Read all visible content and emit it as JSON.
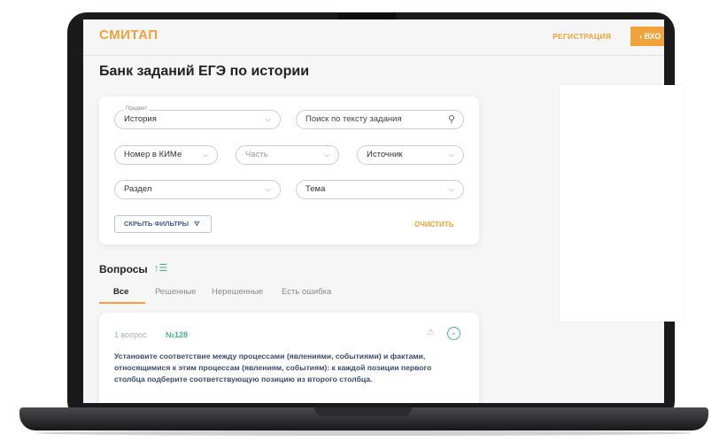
{
  "header": {
    "logo": "СМИТАП",
    "register": "РЕГИСТРАЦИЯ",
    "login": "› ВХО"
  },
  "page": {
    "title": "Банк заданий ЕГЭ по истории"
  },
  "filters": {
    "subject_legend": "Предмет",
    "subject_value": "История",
    "search_placeholder": "Поиск по тексту задания",
    "kim_number": "Номер в КИМе",
    "part": "Часть",
    "source": "Источник",
    "section": "Раздел",
    "topic": "Тема",
    "hide_filters": "СКРЫТЬ ФИЛЬТРЫ",
    "clear": "ОЧИСТИТЬ"
  },
  "questions": {
    "heading": "Вопросы",
    "tabs": [
      "Все",
      "Решенные",
      "Нерешенные",
      "Есть ошибка"
    ],
    "active_tab": "Все",
    "items": [
      {
        "index_label": "1 вопрос",
        "id_label": "№128",
        "text": "Установите соответствие между процессами (явлениями, событиями) и фактами, относящимися к этим процессам (явлениям, событиям): к каждой позиции первого столбца подберите соответствующую позицию из второго столбца."
      }
    ]
  },
  "colors": {
    "accent": "#f0a23c",
    "green": "#4bb38a",
    "text_blue": "#3a4b6a"
  }
}
